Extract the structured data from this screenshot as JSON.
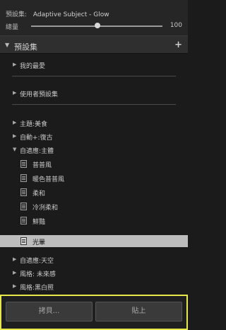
{
  "top": {
    "preset_label": "預設集:",
    "preset_name": "Adaptive Subject - Glow",
    "amount_label": "總量",
    "amount_value": "100",
    "amount_fraction": 0.5
  },
  "panel": {
    "title": "預設集",
    "add_icon": "+"
  },
  "items": {
    "favorites": "我的最愛",
    "user_presets": "使用者預設集",
    "theme_food": "主題:美食",
    "auto_retro": "自動+:復古",
    "adaptive_subject": "自適應:主體",
    "child1": "普普風",
    "child2": "暖色普普風",
    "child3": "柔和",
    "child4": "冷冽柔和",
    "child5": "鮮豔",
    "child6": "光暈",
    "adaptive_sky": "自適應:天空",
    "style_future": "風格: 未來感",
    "style_bw": "風格:黑白照"
  },
  "buttons": {
    "copy": "拷貝...",
    "paste": "貼上"
  },
  "colors": {
    "highlight_border": "#e8e84a",
    "selected_row": "#bdbdbd"
  }
}
